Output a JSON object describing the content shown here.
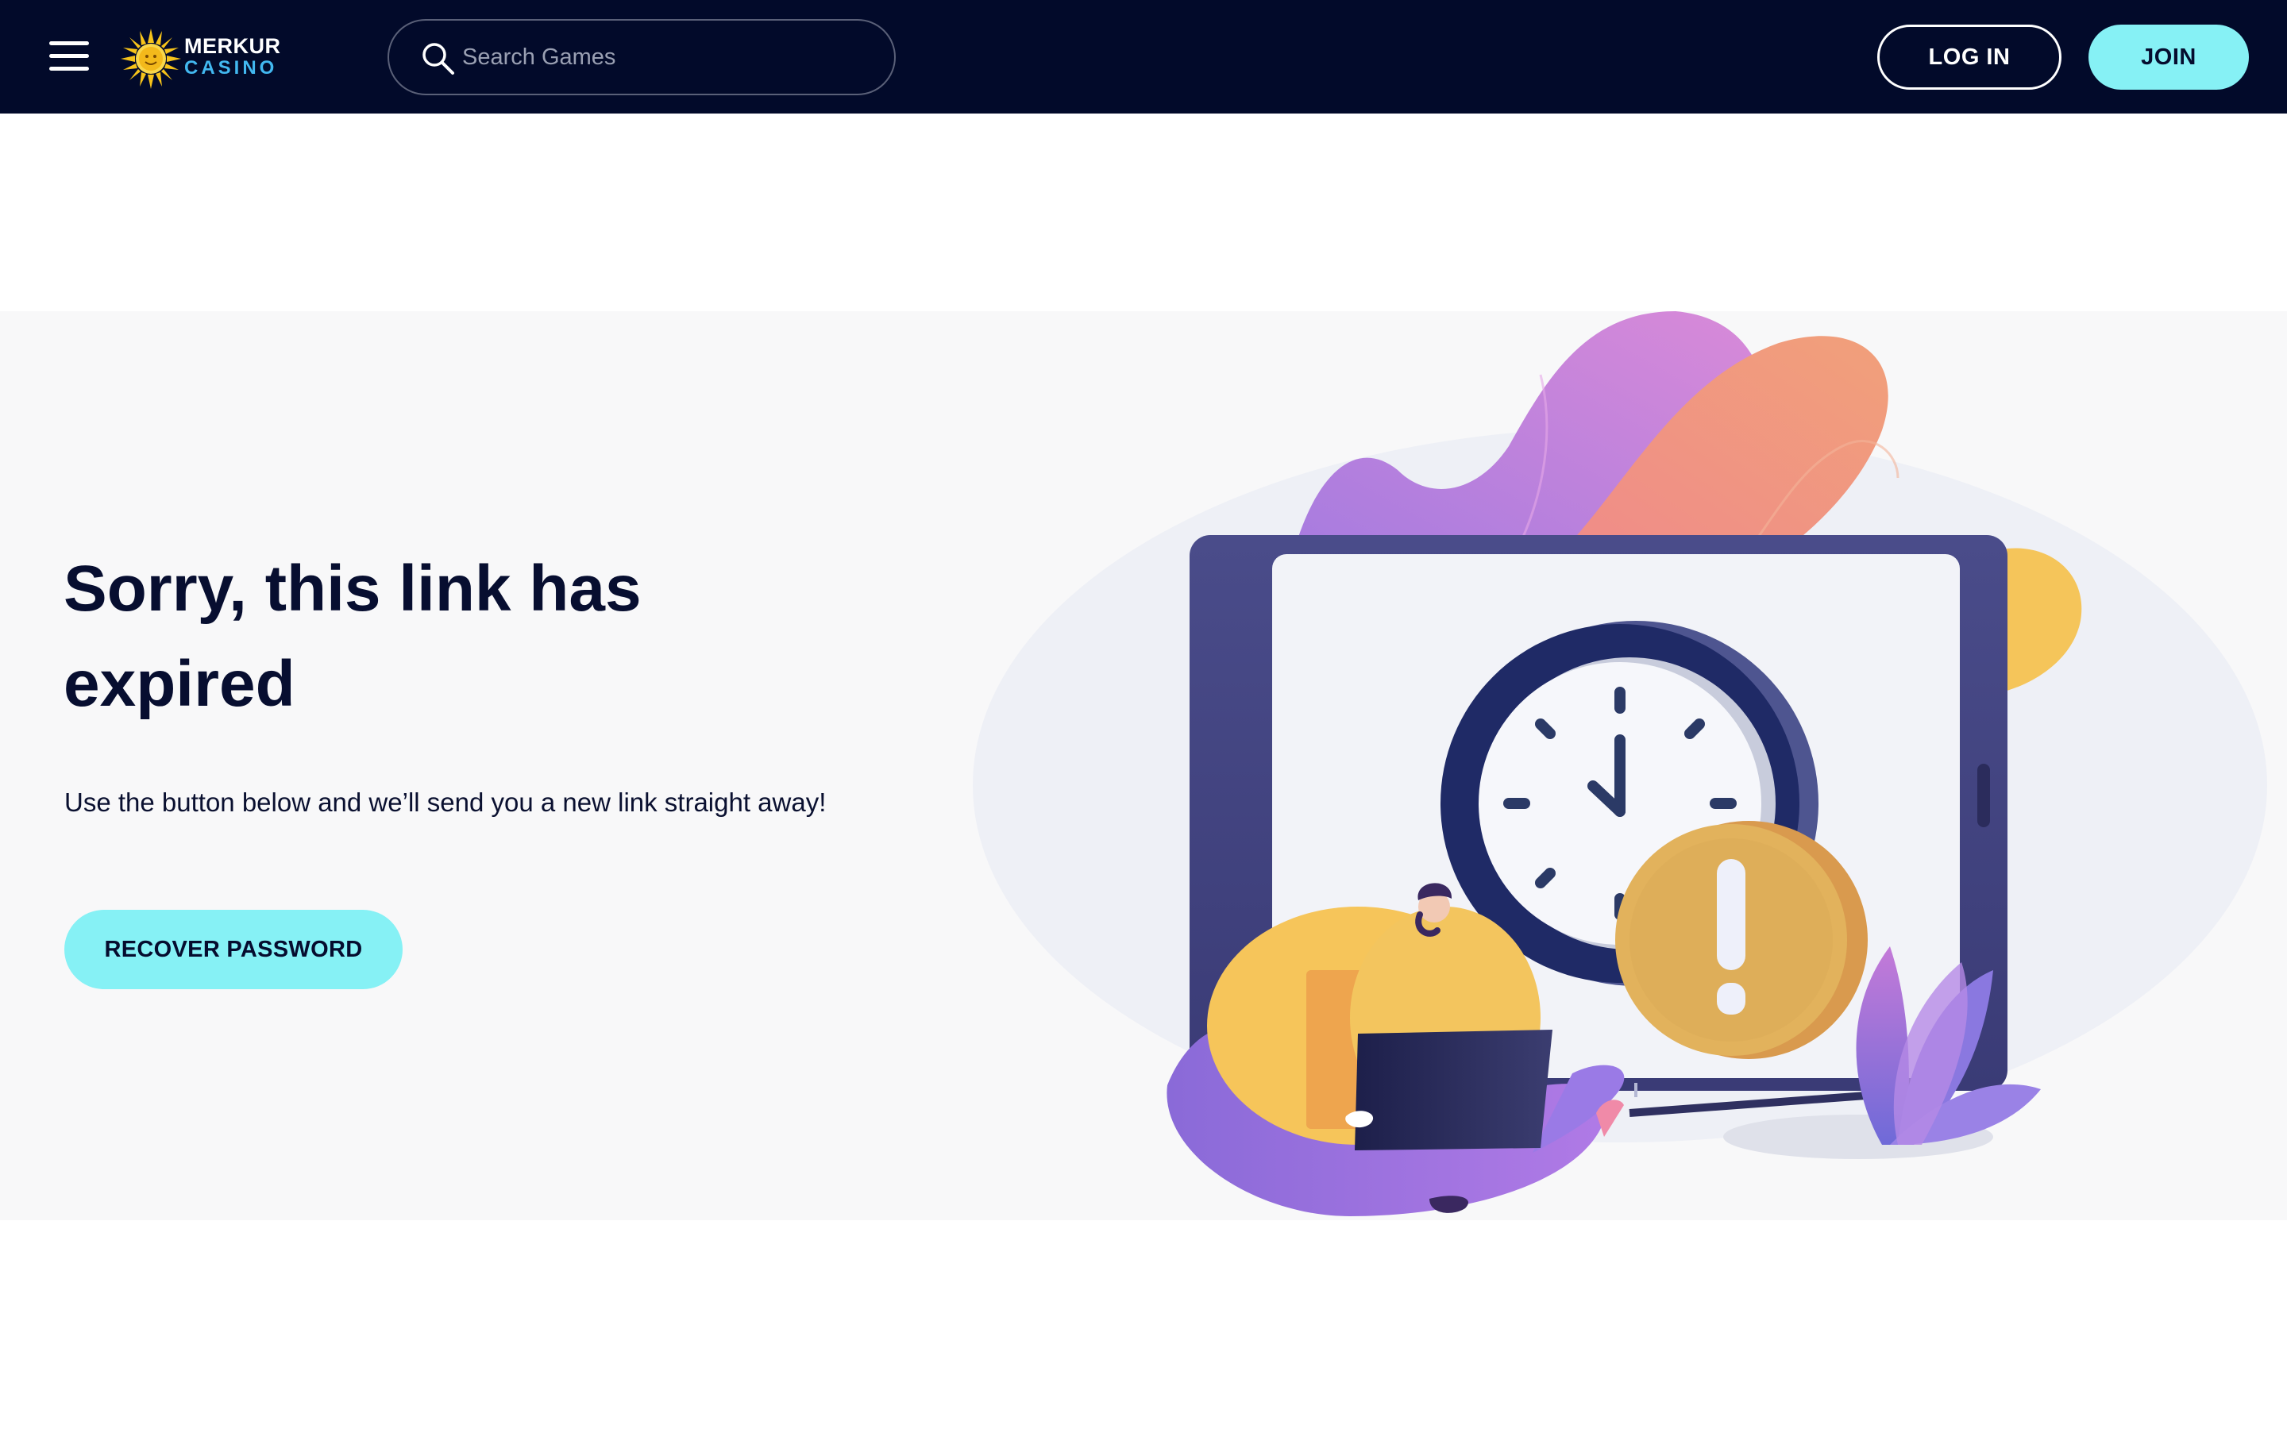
{
  "header": {
    "logo": {
      "line1": "MERKUR",
      "line2": "CASINO"
    },
    "search": {
      "placeholder": "Search Games",
      "value": ""
    },
    "login_label": "LOG IN",
    "join_label": "JOIN"
  },
  "hero": {
    "title": "Sorry, this link has expired",
    "text": "Use the button below and we’ll send you a new link straight away!",
    "recover_label": "RECOVER PASSWORD"
  },
  "icons": {
    "menu": "hamburger-icon",
    "search": "search-icon",
    "logo": "sun-icon",
    "illustration": "expired-clock-illustration"
  },
  "colors": {
    "header_bg": "#020a2a",
    "accent": "#86f1f5",
    "title": "#070e30",
    "hero_bg": "#f8f8f9"
  }
}
